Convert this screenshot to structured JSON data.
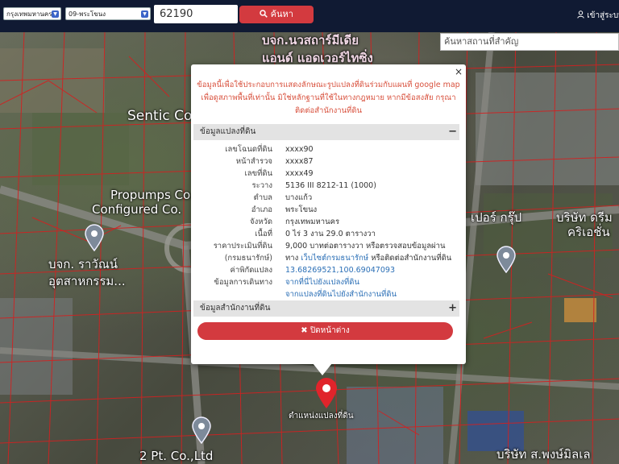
{
  "topbar": {
    "province_select": "กรุงเทพมหานคร",
    "district_select": "09-พระโขนง",
    "search_value": "62190",
    "search_button": "ค้นหา",
    "login": "เข้าสู่ระบบ"
  },
  "map": {
    "place_search_placeholder": "ค้นหาสถานที่สำคัญ",
    "labels": {
      "l1": "บจก.นวสถาร์มีเดีย",
      "l2": "แอนด์ แอดเวอร์ไทซิ่ง",
      "l3": "Sentic Co.",
      "l4": "Propumps Co.,",
      "l5": "Configured Co.",
      "l6": "บจก. ราวัณน์",
      "l7": "อุตสาหกรรม...",
      "l8": "เปอร์ กรุ๊ป",
      "l9": "บริษัท ดรีม",
      "l10": "คริเอชั่น",
      "l11": "2 Pt. Co.,Ltd",
      "l12": "บริษัท ส.พงษ์มิลเล",
      "l13": "ตำแหน่งแปลงที่ดิน"
    }
  },
  "modal": {
    "close_x": "×",
    "notice_line1": "ข้อมูลนี้เพื่อใช้ประกอบการแสดงลักษณะรูปแปลงที่ดินร่วมกับแผนที่ google map",
    "notice_line2": "เพื่อดูสภาพพื้นที่เท่านั้น มิใช่หลักฐานที่ใช้ในทางกฎหมาย หากมีข้อสงสัย กรุณา",
    "notice_line3": "ติดต่อสำนักงานที่ดิน",
    "section1_title": "ข้อมูลแปลงที่ดิน",
    "section1_toggle": "−",
    "rows": {
      "r1_label": "เลขโฉนดที่ดิน",
      "r1_value": "xxxx90",
      "r2_label": "หน้าสำรวจ",
      "r2_value": "xxxx87",
      "r3_label": "เลขที่ดิน",
      "r3_value": "xxxx49",
      "r4_label": "ระวาง",
      "r4_value": "5136 III 8212-11 (1000)",
      "r5_label": "ตำบล",
      "r5_value": "บางแก้ว",
      "r6_label": "อำเภอ",
      "r6_value": "พระโขนง",
      "r7_label": "จังหวัด",
      "r7_value": "กรุงเทพมหานคร",
      "r8_label": "เนื้อที่",
      "r8_value": "0 ไร่ 3 งาน 29.0 ตารางวา",
      "r9_label": "ราคาประเมินที่ดิน",
      "r9_value": "9,000 บาทต่อตารางวา หรือตรวจสอบข้อมูลผ่าน",
      "r10_label": "(กรมธนารักษ์)",
      "r10_value_prefix": "ทาง",
      "r10_value_link": "เว็บไซต์กรมธนารักษ์",
      "r10_value_suffix": "หรือติดต่อสำนักงานที่ดิน",
      "r11_label": "ค่าพิกัดแปลง",
      "r11_value": "13.68269521,100.69047093",
      "r12_label": "ข้อมูลการเดินทาง",
      "r12_value": "จากที่นี่ไปยังแปลงที่ดิน",
      "r13_value": "จากแปลงที่ดินไปยังสำนักงานที่ดิน"
    },
    "section2_title": "ข้อมูลสำนักงานที่ดิน",
    "section2_toggle": "+",
    "close_button": "✖ ปิดหน้าต่าง"
  }
}
